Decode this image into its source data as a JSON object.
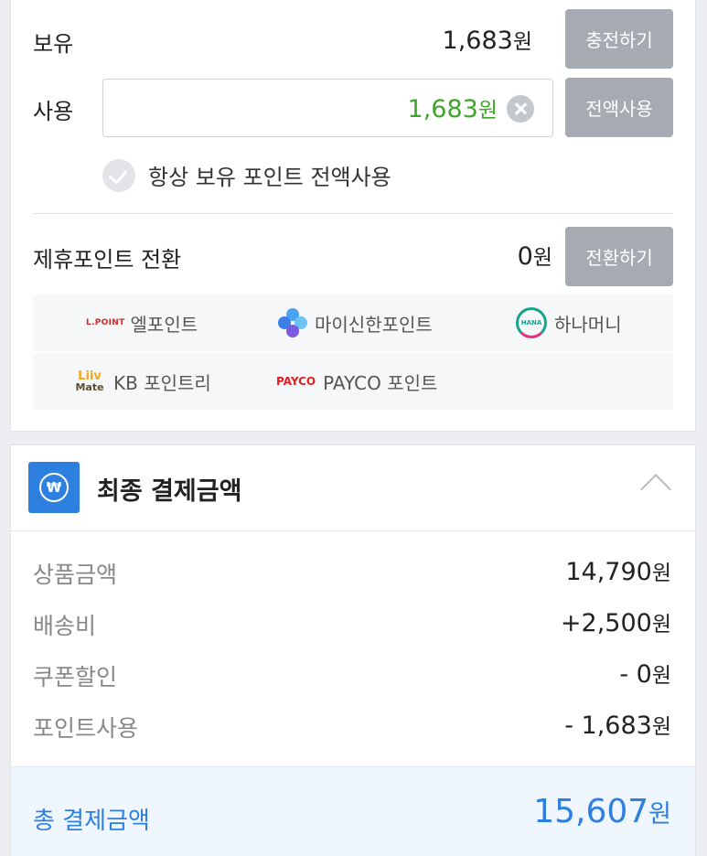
{
  "points": {
    "owned_label": "보유",
    "owned_amount": "1,683",
    "currency": "원",
    "charge_button": "충전하기",
    "use_label": "사용",
    "use_value": "1,683",
    "use_all_button": "전액사용",
    "always_use_all_label": "항상 보유 포인트 전액사용",
    "always_use_all_checked": false
  },
  "partner_points": {
    "label": "제휴포인트 전환",
    "amount": "0",
    "convert_button": "전환하기",
    "items": [
      {
        "logo_text": "L.POINT",
        "name": "엘포인트"
      },
      {
        "name": "마이신한포인트",
        "icon": "shinhan-icon"
      },
      {
        "logo_text": "HANA",
        "name": "하나머니"
      },
      {
        "logo_text_top": "Liiv",
        "logo_text_bottom": "Mate",
        "name": "KB 포인트리"
      },
      {
        "logo_text": "PAYCO",
        "name": "PAYCO 포인트"
      }
    ]
  },
  "payment": {
    "title": "최종 결제금액",
    "icon_symbol": "₩",
    "rows": [
      {
        "label": "상품금액",
        "value": "14,790"
      },
      {
        "label": "배송비",
        "value": "+2,500"
      },
      {
        "label": "쿠폰할인",
        "value": "- 0"
      },
      {
        "label": "포인트사용",
        "value": "- 1,683"
      }
    ],
    "total_label": "총 결제금액",
    "total_value": "15,607"
  },
  "colors": {
    "accent_blue": "#2d7fe0",
    "use_green": "#3fa42b",
    "button_gray": "#a6aab1"
  }
}
